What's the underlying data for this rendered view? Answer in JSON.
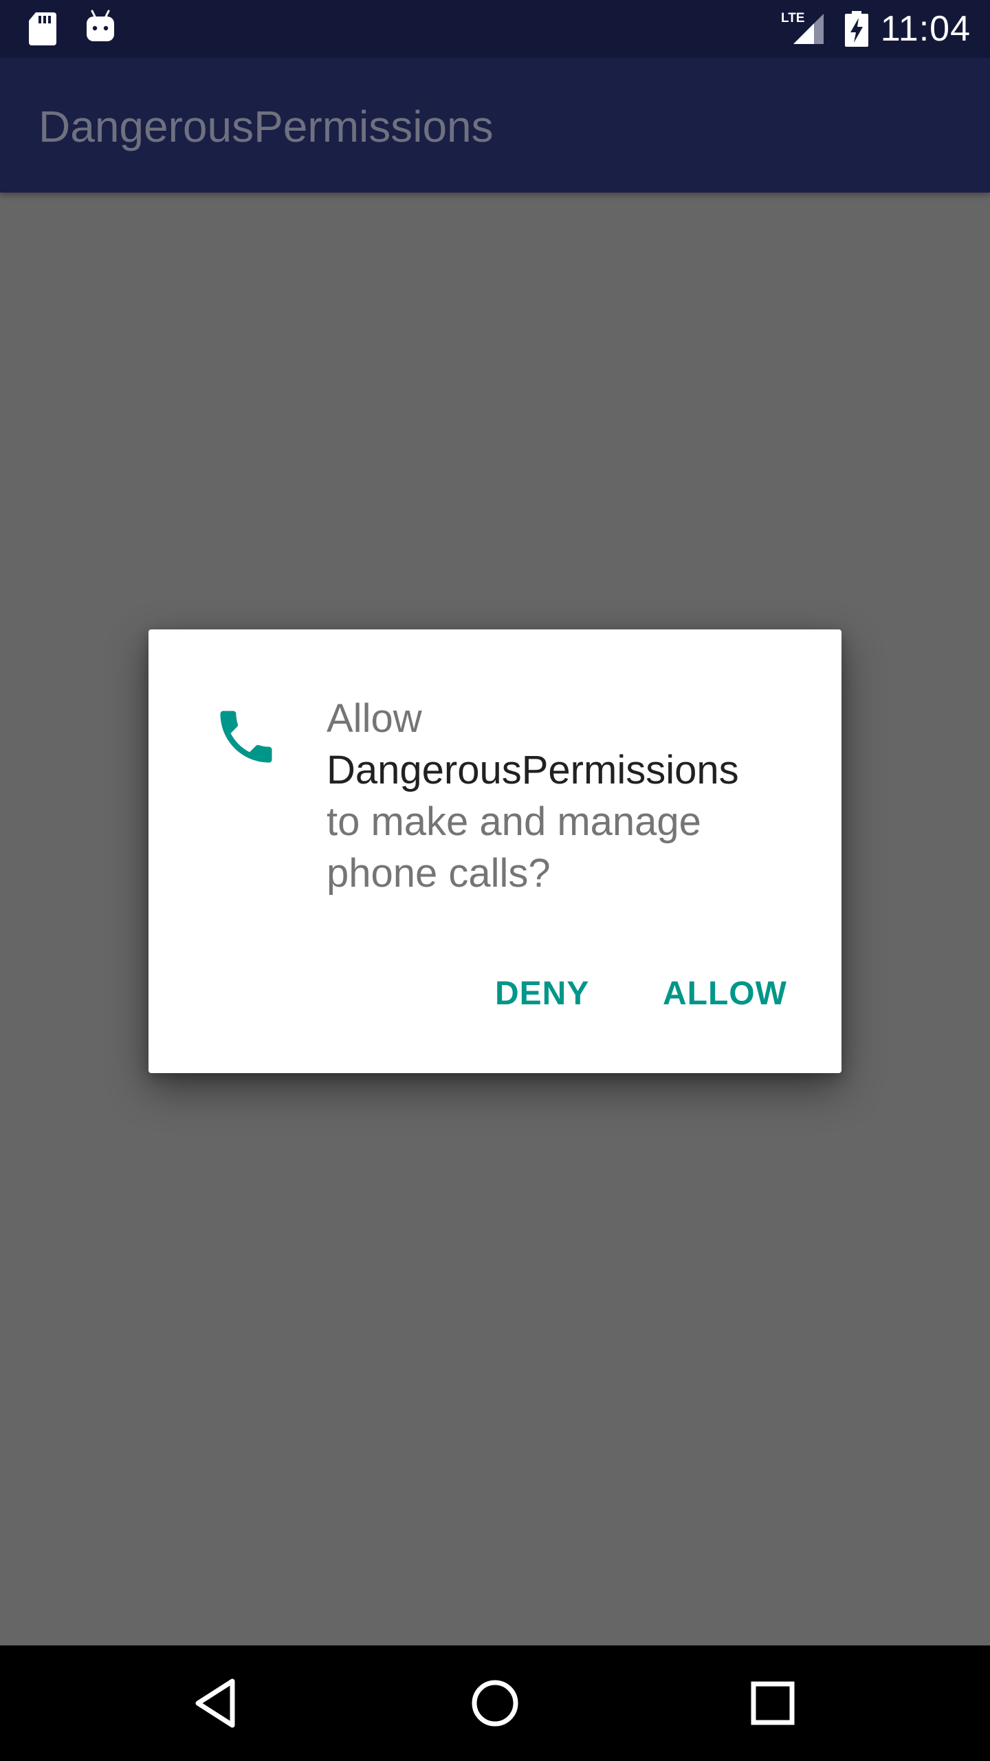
{
  "status_bar": {
    "time": "11:04",
    "network": "LTE",
    "icons": [
      "sd-card-icon",
      "android-icon",
      "lte-signal-icon",
      "battery-charging-icon"
    ]
  },
  "app_bar": {
    "title": "DangerousPermissions"
  },
  "dialog": {
    "icon": "phone-icon",
    "message_prefix": "Allow",
    "app_name": "DangerousPermissions",
    "message_line_1": "to make and manage",
    "message_line_2": "phone calls?",
    "deny_label": "DENY",
    "allow_label": "ALLOW"
  },
  "nav_bar": {
    "icons": [
      "back-icon",
      "home-icon",
      "recents-icon"
    ]
  },
  "colors": {
    "status_bar": "#141838",
    "app_bar": "#1a1f46",
    "scrim_background": "#666666",
    "accent": "#00968a",
    "nav_bar": "#000000"
  }
}
